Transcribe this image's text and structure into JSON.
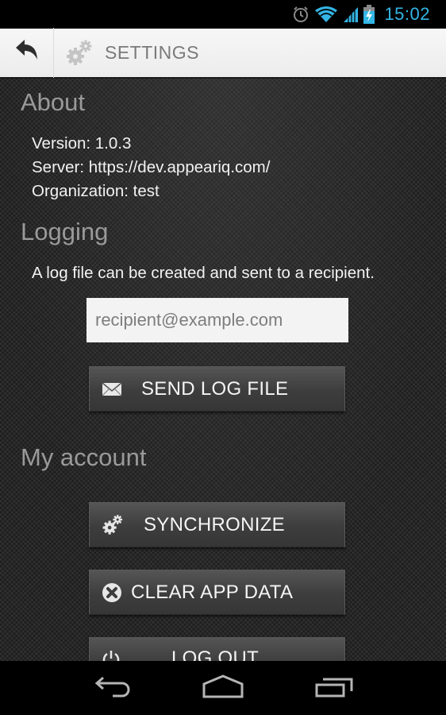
{
  "status_bar": {
    "time": "15:02",
    "icons": [
      "alarm-icon",
      "wifi-icon",
      "cell-signal-icon",
      "battery-charging-icon"
    ],
    "accent_color": "#33b5e5"
  },
  "action_bar": {
    "title": "SETTINGS",
    "back_icon": "back-arrow-icon",
    "app_icon": "gears-icon"
  },
  "about": {
    "title": "About",
    "version_line": "Version: 1.0.3",
    "server_line": "Server: https://dev.appeariq.com/",
    "organization_line": "Organization: test"
  },
  "logging": {
    "title": "Logging",
    "description": "A log file can be created and sent to a recipient.",
    "recipient_value": "",
    "recipient_placeholder": "recipient@example.com",
    "send_button": {
      "label": "SEND LOG FILE",
      "icon": "envelope-icon"
    }
  },
  "account": {
    "title": "My account",
    "buttons": [
      {
        "label": "SYNCHRONIZE",
        "icon": "gears-icon"
      },
      {
        "label": "CLEAR APP DATA",
        "icon": "clear-x-icon"
      },
      {
        "label": "LOG OUT",
        "icon": "power-icon"
      }
    ]
  },
  "nav_bar": {
    "buttons": [
      "back",
      "home",
      "recent-apps"
    ]
  }
}
